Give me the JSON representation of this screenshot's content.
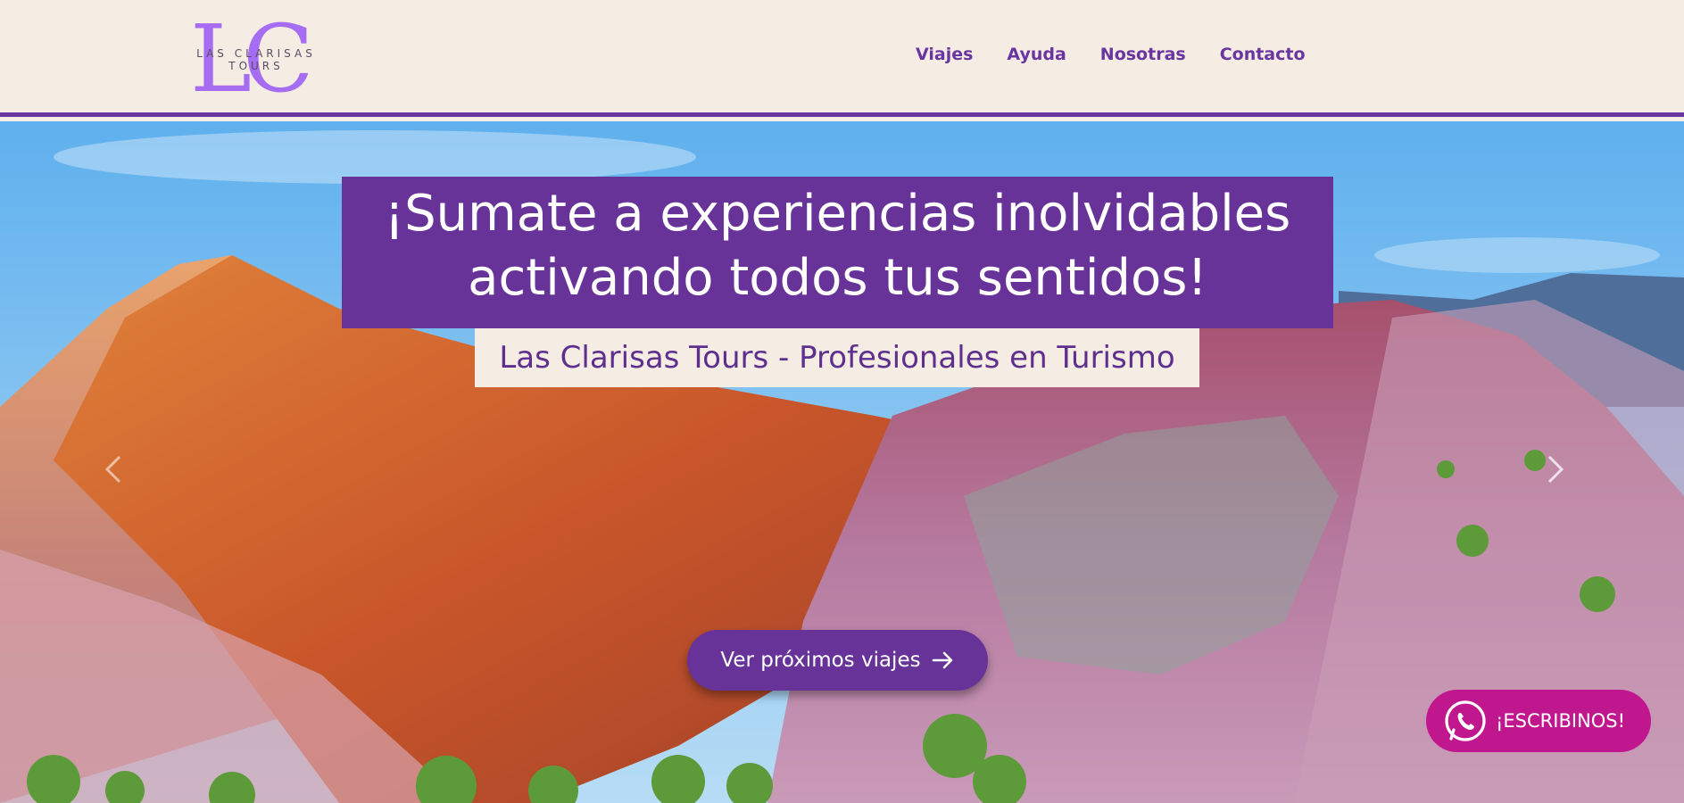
{
  "header": {
    "logo": {
      "monogram": "LC",
      "line1": "LAS CLARISAS",
      "line2": "TOURS"
    },
    "nav": [
      {
        "label": "Viajes"
      },
      {
        "label": "Ayuda"
      },
      {
        "label": "Nosotras"
      },
      {
        "label": "Contacto"
      }
    ]
  },
  "hero": {
    "headline": "¡Sumate a experiencias inolvidables activando todos tus sentidos!",
    "subtitle": "Las Clarisas Tours - Profesionales en Turismo",
    "cta_label": "Ver próximos viajes",
    "cta_icon": "arrow-right-icon",
    "carousel_prev_icon": "chevron-left-icon",
    "carousel_next_icon": "chevron-right-icon"
  },
  "whatsapp": {
    "label": "¡ESCRIBINOS!",
    "icon": "whatsapp-icon"
  },
  "colors": {
    "brand_purple": "#673399",
    "header_bg": "#f5ede3",
    "whatsapp_magenta": "#c0178e",
    "logo_violet": "#a66cf2"
  }
}
